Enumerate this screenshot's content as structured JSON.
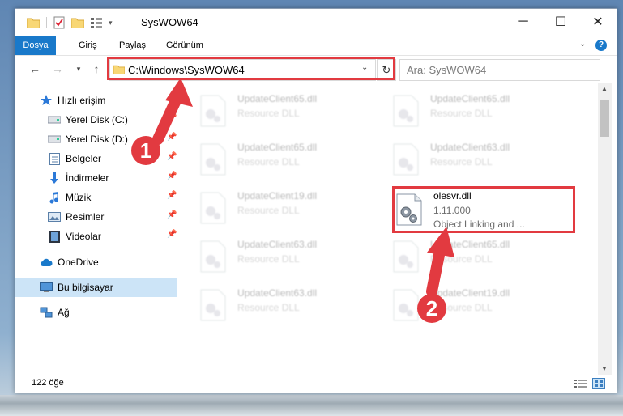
{
  "window": {
    "title": "SysWOW64",
    "minimize_glyph": "─",
    "maximize_glyph": "☐",
    "close_glyph": "✕"
  },
  "ribbon": {
    "tabs": [
      "Dosya",
      "Giriş",
      "Paylaş",
      "Görünüm"
    ],
    "help_glyph": "?"
  },
  "address": {
    "path": "C:\\Windows\\SysWOW64",
    "search_placeholder": "Ara: SysWOW64"
  },
  "nav": {
    "quick_access": "Hızlı erişim",
    "items": [
      {
        "label": "Yerel Disk (C:)",
        "icon": "drive-icon"
      },
      {
        "label": "Yerel Disk (D:)",
        "icon": "drive-icon"
      },
      {
        "label": "Belgeler",
        "icon": "documents-icon"
      },
      {
        "label": "İndirmeler",
        "icon": "downloads-icon"
      },
      {
        "label": "Müzik",
        "icon": "music-icon"
      },
      {
        "label": "Resimler",
        "icon": "pictures-icon"
      },
      {
        "label": "Videolar",
        "icon": "videos-icon"
      }
    ],
    "onedrive": "OneDrive",
    "this_pc": "Bu bilgisayar",
    "network": "Ağ"
  },
  "files": [
    {
      "name": "UpdateClient65.dll",
      "desc": "Resource DLL",
      "faded": true
    },
    {
      "name": "UpdateClient65.dll",
      "desc": "Resource DLL",
      "faded": true
    },
    {
      "name": "UpdateClient65.dll",
      "desc": "Resource DLL",
      "faded": true
    },
    {
      "name": "UpdateClient63.dll",
      "desc": "Resource DLL",
      "faded": true
    },
    {
      "name": "UpdateClient19.dll",
      "desc": "Resource DLL",
      "faded": true
    },
    {
      "name": "olesvr.dll",
      "version": "1.11.000",
      "desc": "Object Linking and ...",
      "faded": false
    },
    {
      "name": "UpdateClient63.dll",
      "desc": "Resource DLL",
      "faded": true
    },
    {
      "name": "UpdateClient65.dll",
      "desc": "Resource DLL",
      "faded": true
    },
    {
      "name": "UpdateClient63.dll",
      "desc": "Resource DLL",
      "faded": true
    },
    {
      "name": "UpdateClient19.dll",
      "desc": "Resource DLL",
      "faded": true
    }
  ],
  "status": {
    "count": "122 öğe"
  },
  "annotations": {
    "step1": "1",
    "step2": "2",
    "accent_color": "#e23a40"
  }
}
